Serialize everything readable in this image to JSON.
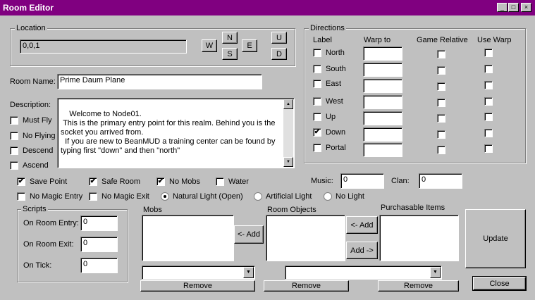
{
  "window": {
    "title": "Room Editor",
    "minimize": "_",
    "maximize": "□",
    "close": "×"
  },
  "location": {
    "group_label": "Location",
    "value": "0,0,1",
    "buttons": {
      "w": "W",
      "n": "N",
      "s": "S",
      "e": "E",
      "u": "U",
      "d": "D"
    }
  },
  "room_name": {
    "label": "Room Name:",
    "value": "Prime Daum Plane"
  },
  "description": {
    "label": "Description:",
    "text": "Welcome to Node01.\n This is the primary entry point for this realm. Behind you is the socket you arrived from.\n  If you are new to BeanMUD a training center can be found by typing first \"down\" and then \"north\""
  },
  "side_flags": [
    {
      "label": "Must Fly",
      "checked": false
    },
    {
      "label": "No Flying",
      "checked": false
    },
    {
      "label": "Descend",
      "checked": false
    },
    {
      "label": "Ascend",
      "checked": false
    }
  ],
  "directions": {
    "group_label": "Directions",
    "headers": {
      "label": "Label",
      "warp_to": "Warp to",
      "game_relative": "Game Relative",
      "use_warp": "Use Warp"
    },
    "rows": [
      {
        "label": "North",
        "checked": false,
        "warp": ""
      },
      {
        "label": "South",
        "checked": false,
        "warp": ""
      },
      {
        "label": "East",
        "checked": false,
        "warp": ""
      },
      {
        "label": "West",
        "checked": false,
        "warp": ""
      },
      {
        "label": "Up",
        "checked": false,
        "warp": ""
      },
      {
        "label": "Down",
        "checked": true,
        "warp": ""
      },
      {
        "label": "Portal",
        "checked": false,
        "warp": ""
      }
    ]
  },
  "flags_row1": [
    {
      "label": "Save Point",
      "checked": true
    },
    {
      "label": "Safe Room",
      "checked": true
    },
    {
      "label": "No Mobs",
      "checked": true
    },
    {
      "label": "Water",
      "checked": false
    }
  ],
  "flags_row2": [
    {
      "label": "No Magic Entry",
      "checked": false
    },
    {
      "label": "No Magic Exit",
      "checked": false
    }
  ],
  "lighting": [
    {
      "label": "Natural Light (Open)",
      "selected": true
    },
    {
      "label": "Artificial Light",
      "selected": false
    },
    {
      "label": "No Light",
      "selected": false
    }
  ],
  "music": {
    "label": "Music:",
    "value": "0"
  },
  "clan": {
    "label": "Clan:",
    "value": "0"
  },
  "scripts": {
    "group_label": "Scripts",
    "on_entry": {
      "label": "On Room Entry:",
      "value": "0"
    },
    "on_exit": {
      "label": "On Room Exit:",
      "value": "0"
    },
    "on_tick": {
      "label": "On Tick:",
      "value": "0"
    }
  },
  "mobs": {
    "label": "Mobs",
    "add": "<- Add",
    "remove": "Remove",
    "select": ""
  },
  "room_objects": {
    "label": "Room Objects",
    "add_left": "<- Add",
    "add_right": "Add ->",
    "remove": "Remove",
    "select": ""
  },
  "purchasable": {
    "label": "Purchasable Items",
    "remove": "Remove"
  },
  "actions": {
    "update": "Update",
    "close": "Close"
  }
}
